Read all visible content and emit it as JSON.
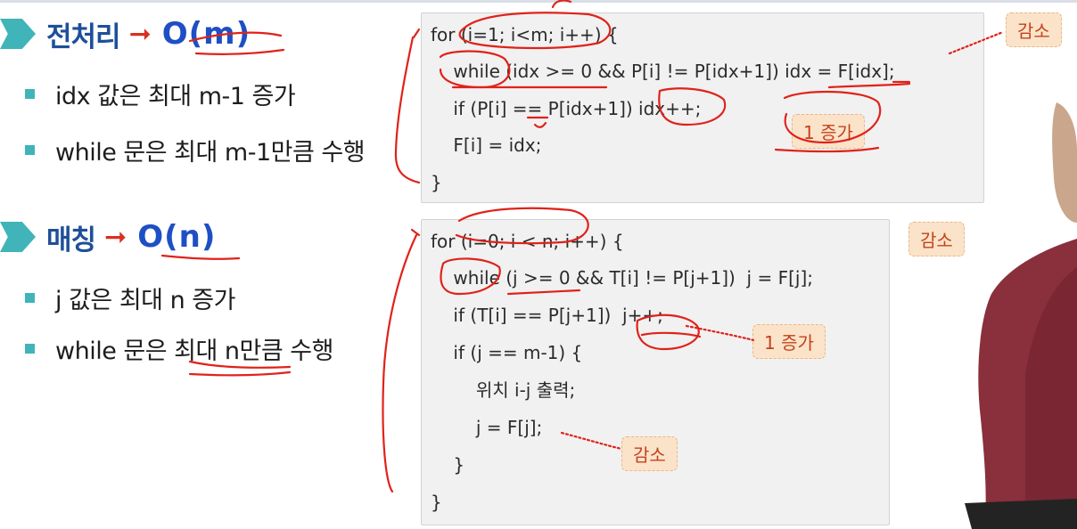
{
  "sections": [
    {
      "title": "전처리",
      "complexity": "O(m)",
      "bullets": [
        "idx 값은 최대 m-1 증가",
        "while 문은 최대 m-1만큼 수행"
      ],
      "code": [
        "for (i=1; i<m; i++) {",
        "    while (idx >= 0 && P[i] != P[idx+1]) idx = F[idx];",
        "    if (P[i] == P[idx+1]) idx++;",
        "    F[i] = idx;",
        "}"
      ],
      "tags": [
        "감소",
        "1 증가"
      ]
    },
    {
      "title": "매칭",
      "complexity": "O(n)",
      "bullets": [
        "j 값은 최대 n 증가",
        "while 문은 최대 n만큼 수행"
      ],
      "code": [
        "for (i=0; i < n; i++) {",
        "    while (j >= 0 && T[i] != P[j+1])  j = F[j];",
        "    if (T[i] == P[j+1])  j++;",
        "    if (j == m-1) {",
        "        위치 i-j 출력;",
        "        j = F[j];",
        "    }",
        "}"
      ],
      "tags": [
        "감소",
        "1 증가",
        "감소"
      ]
    }
  ],
  "colors": {
    "accent": "#40b4b8",
    "title": "#1e4f9a",
    "complexity": "#1e4fc4",
    "arrow": "#d9301f",
    "ink": "#e0221a",
    "tag_bg": "#fbe3c9",
    "tag_text": "#c2431d"
  }
}
